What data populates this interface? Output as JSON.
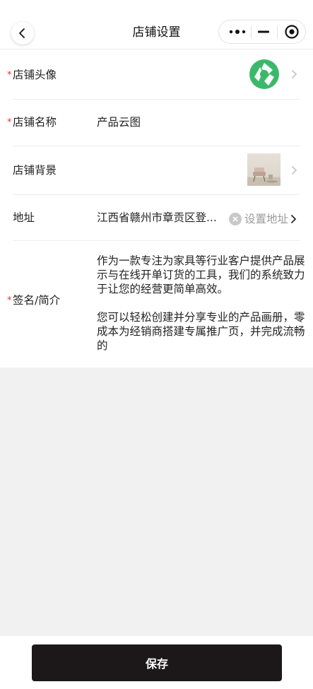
{
  "header": {
    "title": "店铺设置"
  },
  "form": {
    "avatar": {
      "label": "店铺头像",
      "required_mark": "*"
    },
    "name": {
      "label": "店铺名称",
      "required_mark": "*",
      "value": "产品云图"
    },
    "background": {
      "label": "店铺背景"
    },
    "address": {
      "label": "地址",
      "value": "江西省赣州市章贡区登...",
      "action": "设置地址"
    },
    "bio": {
      "label": "签名/简介",
      "required_mark": "*",
      "value": "作为一款专注为家具等行业客户提供产品展示与在线开单订货的工具，我们的系统致力于让您的经营更简单高效。\n\n您可以轻松创建并分享专业的产品画册，零成本为经销商搭建专属推广页，并完成流畅的"
    }
  },
  "footer": {
    "save_label": "保存"
  },
  "colors": {
    "accent": "#1c1718",
    "required": "#e5342c",
    "logo_green": "#3cb86a"
  },
  "icons": [
    "back-arrow-icon",
    "more-dots-icon",
    "minimize-icon",
    "target-icon",
    "chevron-right-icon",
    "clear-icon",
    "store-logo"
  ]
}
